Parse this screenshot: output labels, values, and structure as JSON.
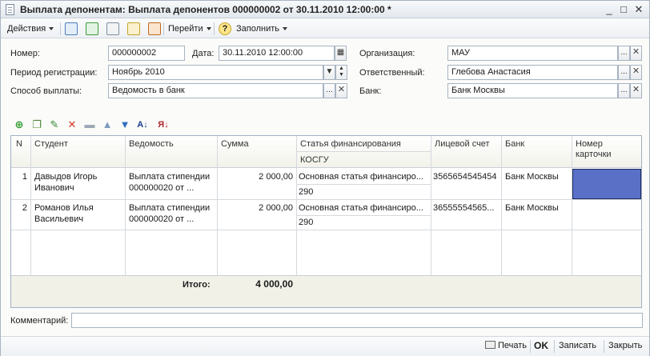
{
  "window": {
    "title": "Выплата депонентам: Выплата депонентов 000000002 от 30.11.2010 12:00:00 *",
    "minimize": "_",
    "maximize": "□",
    "close": "✕"
  },
  "toolbar": {
    "actions": "Действия",
    "goto": "Перейти",
    "help": "?",
    "fill": "Заполнить"
  },
  "form": {
    "number_label": "Номер:",
    "number_value": "000000002",
    "date_label": "Дата:",
    "date_value": "30.11.2010 12:00:00",
    "org_label": "Организация:",
    "org_value": "МАУ",
    "period_label": "Период регистрации:",
    "period_value": "Ноябрь 2010",
    "responsible_label": "Ответственный:",
    "responsible_value": "Глебова Анастасия",
    "method_label": "Способ выплаты:",
    "method_value": "Ведомость в банк",
    "bank_label": "Банк:",
    "bank_value": "Банк Москвы",
    "select_btn": "...",
    "clear_btn": "✕"
  },
  "table": {
    "headers": {
      "n": "N",
      "student": "Студент",
      "statement": "Ведомость",
      "sum": "Сумма",
      "fin_article": "Статья финансирования",
      "kosgu": "КОСГУ",
      "account": "Лицевой счет",
      "bank": "Банк",
      "card": "Номер карточки"
    },
    "rows": [
      {
        "n": "1",
        "student_1": "Давыдов Игорь",
        "student_2": "Иванович",
        "statement_1": "Выплата стипендии",
        "statement_2": "000000020 от ...",
        "sum": "2 000,00",
        "fin_article": "Основная статья финансиро...",
        "kosgu": "290",
        "account": "3565654545454",
        "bank": "Банк Москвы",
        "card": ""
      },
      {
        "n": "2",
        "student_1": "Романов Илья",
        "student_2": "Васильевич",
        "statement_1": "Выплата стипендии",
        "statement_2": "000000020 от ...",
        "sum": "2 000,00",
        "fin_article": "Основная статья финансиро...",
        "kosgu": "290",
        "account": "36555554565...",
        "bank": "Банк Москвы",
        "card": ""
      }
    ],
    "footer": {
      "total_label": "Итого:",
      "total_value": "4 000,00"
    }
  },
  "comment": {
    "label": "Комментарий:",
    "value": ""
  },
  "bottom": {
    "print": "Печать",
    "ok": "OK",
    "save": "Записать",
    "close": "Закрыть"
  },
  "colors": {
    "selection": "#5a6fc6"
  }
}
